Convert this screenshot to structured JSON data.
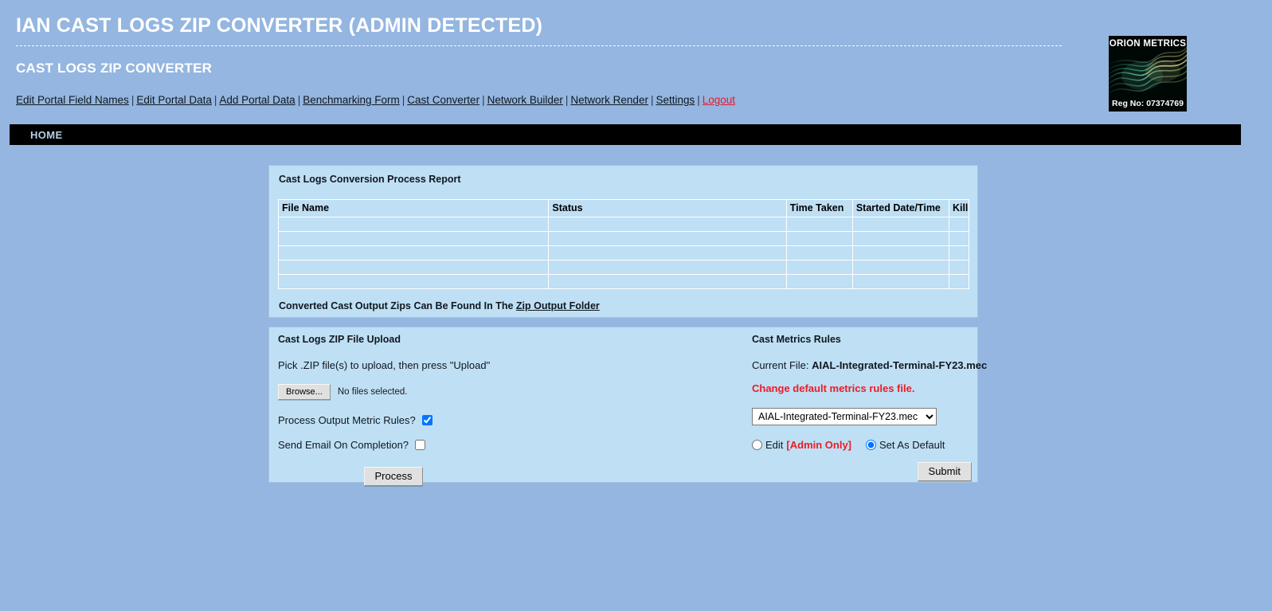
{
  "header": {
    "main_title": "IAN CAST LOGS ZIP CONVERTER (ADMIN DETECTED)",
    "sub_title": "CAST LOGS ZIP CONVERTER"
  },
  "nav": {
    "separator": "|",
    "items": [
      {
        "label": "Edit Portal Field Names",
        "style": "normal"
      },
      {
        "label": "Edit Portal Data",
        "style": "normal"
      },
      {
        "label": "Add Portal Data",
        "style": "normal"
      },
      {
        "label": "Benchmarking Form",
        "style": "normal"
      },
      {
        "label": "Cast Converter",
        "style": "normal"
      },
      {
        "label": "Network Builder",
        "style": "normal"
      },
      {
        "label": "Network Render",
        "style": "normal"
      },
      {
        "label": "Settings",
        "style": "normal"
      },
      {
        "label": "Logout",
        "style": "logout"
      }
    ]
  },
  "logo": {
    "title": "ORION METRICS",
    "reg": "Reg No: 07374769"
  },
  "menubar": {
    "home_label": "HOME"
  },
  "report": {
    "title": "Cast Logs Conversion Process Report",
    "columns": [
      "File Name",
      "Status",
      "Time Taken",
      "Started Date/Time",
      "Kill"
    ],
    "rows": [
      [
        "",
        "",
        "",
        "",
        ""
      ],
      [
        "",
        "",
        "",
        "",
        ""
      ],
      [
        "",
        "",
        "",
        "",
        ""
      ],
      [
        "",
        "",
        "",
        "",
        ""
      ],
      [
        "",
        "",
        "",
        "",
        ""
      ]
    ],
    "note_prefix": "Converted Cast Output Zips Can Be Found In The ",
    "note_link": "Zip Output Folder"
  },
  "upload": {
    "title": "Cast Logs ZIP File Upload",
    "hint": "Pick .ZIP file(s) to upload, then press \"Upload\"",
    "browse_label": "Browse...",
    "file_status": "No files selected.",
    "metric_rules_label": "Process Output Metric Rules?",
    "metric_rules_checked": true,
    "email_label": "Send Email On Completion?",
    "email_checked": false,
    "process_label": "Process"
  },
  "metrics": {
    "title": "Cast Metrics Rules",
    "current_file_label": "Current File:",
    "current_file_value": "AIAL-Integrated-Terminal-FY23.mec",
    "change_note": "Change default metrics rules file.",
    "select_value": "AIAL-Integrated-Terminal-FY23.mec",
    "select_options": [
      "AIAL-Integrated-Terminal-FY23.mec"
    ],
    "edit_label": "Edit",
    "admin_only_label": "[Admin Only]",
    "set_default_label": "Set As Default",
    "selected_radio": "set_default",
    "submit_label": "Submit"
  },
  "colors": {
    "page_background": "#94b6e0",
    "panel_background": "#bfdff4",
    "accent_red": "#ee1b24",
    "bar_black": "#000000",
    "home_link": "#b7cfe8"
  }
}
